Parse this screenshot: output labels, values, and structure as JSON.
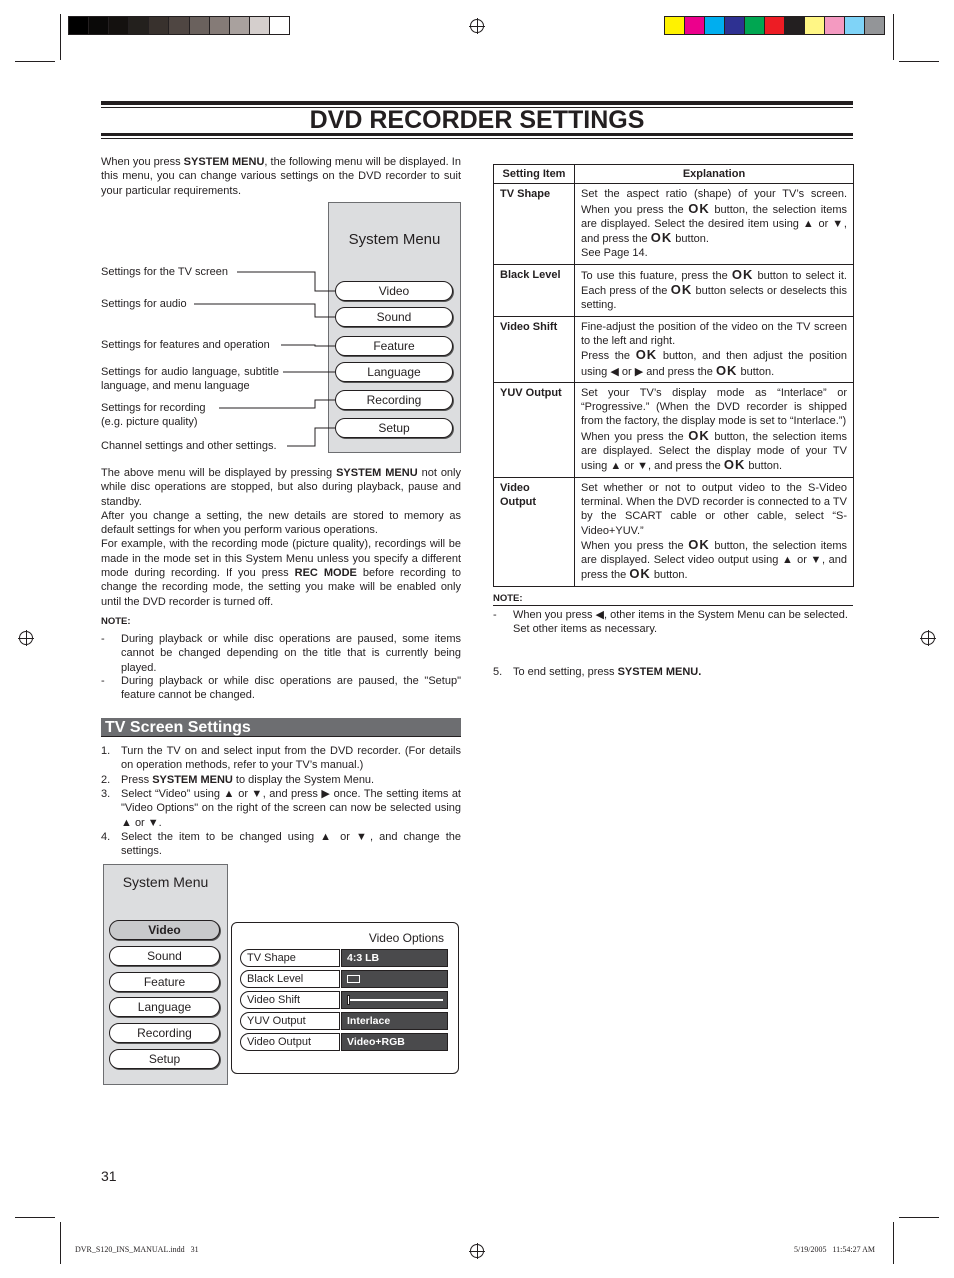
{
  "colors": {
    "grayscale": [
      "#000000",
      "#0a0908",
      "#14110f",
      "#23201d",
      "#38312d",
      "#4f4642",
      "#6a615d",
      "#857b77",
      "#a9a19e",
      "#d5cfcd",
      "#ffffff"
    ],
    "process": [
      "#fff200",
      "#ec008c",
      "#00aeef",
      "#2e3192",
      "#00a651",
      "#ed1c24",
      "#231f20",
      "#fff685",
      "#f49ac1",
      "#7fd3f7",
      "#939598"
    ],
    "section_header_bg": "#6d6e71"
  },
  "title": "DVD RECORDER SETTINGS",
  "intro": [
    "When you press ",
    {
      "b": "SYSTEM MENU"
    },
    ", the following menu will be displayed. In this menu, you can change various settings on the DVD recorder to suit your particular requirements."
  ],
  "diagram1": {
    "title": "System Menu",
    "buttons": [
      "Video",
      "Sound",
      "Feature",
      "Language",
      "Recording",
      "Setup"
    ],
    "labels": [
      "Settings for the TV screen",
      "Settings for audio",
      "Settings for features and operation",
      "Settings for audio language, subtitle language, and menu language",
      "Settings for recording (e.g. picture quality)",
      "Channel settings and other settings."
    ]
  },
  "para2": [
    "The above menu will be displayed by pressing ",
    {
      "b": "SYSTEM MENU"
    },
    " not only while disc operations are stopped, but also during playback, pause and standby.\nAfter you change a setting, the new details are stored to memory as default settings for when you perform various operations.\nFor example, with the recording mode (picture quality), recordings will be made in the mode set in this System Menu unless you specify a different mode during recording. If you press ",
    {
      "b": "REC MODE"
    },
    " before recording to change the recording mode, the setting you make will be enabled only until the DVD recorder is turned off."
  ],
  "note1": {
    "label": "NOTE:",
    "items": [
      "During playback or while disc operations are paused, some items cannot be changed depending on the title that is currently being played.",
      "During playback or while disc operations are paused, the \"Setup\" feature cannot be changed."
    ]
  },
  "section": "TV Screen Settings",
  "steps": [
    [
      "Turn the TV on and select input from the DVD recorder. (For details on operation methods, refer to your TV’s manual.)"
    ],
    [
      "Press ",
      {
        "b": "SYSTEM MENU"
      },
      "  to display the System Menu."
    ],
    [
      "Select “Video” using ▲ or ▼, and press ▶ once. The setting items at \"Video Options\" on the right of the screen can now be selected using ▲ or ▼."
    ],
    [
      "Select the item to be changed using ▲ or ▼, and change the settings."
    ]
  ],
  "diagram2": {
    "title": "System Menu",
    "buttons": [
      "Video",
      "Sound",
      "Feature",
      "Language",
      "Recording",
      "Setup"
    ],
    "selected": "Video",
    "options_title": "Video Options",
    "options": [
      {
        "label": "TV Shape",
        "value": "4:3 LB"
      },
      {
        "label": "Black Level",
        "value": ""
      },
      {
        "label": "Video Shift",
        "value": ""
      },
      {
        "label": "YUV Output",
        "value": "Interlace"
      },
      {
        "label": "Video Output",
        "value": "Video+RGB"
      }
    ]
  },
  "table": {
    "headers": [
      "Setting Item",
      "Explanation"
    ],
    "rows": [
      {
        "item": "TV Shape",
        "text": [
          "Set the aspect ratio (shape) of your TV’s screen. When you press the ",
          {
            "ok": "OK"
          },
          " button, the selection items are displayed. Select the desired item using ▲ or ▼, and press the ",
          {
            "ok": "OK"
          },
          " button.\nSee Page 14."
        ]
      },
      {
        "item": "Black Level",
        "text": [
          "To use this fuature, press the ",
          {
            "ok": "OK"
          },
          " button to select it. Each press of the ",
          {
            "ok": "OK"
          },
          " button selects or deselects this setting."
        ]
      },
      {
        "item": "Video Shift",
        "text": [
          "Fine-adjust the position of the video on the TV screen to the left and right.\nPress the ",
          {
            "ok": "OK"
          },
          " button, and then adjust the position using ◀ or ▶ and press the ",
          {
            "ok": "OK"
          },
          " button."
        ]
      },
      {
        "item": "YUV Output",
        "text": [
          "Set your TV’s display mode as “Interlace” or “Progressive.” (When the DVD recorder is shipped from the factory, the display mode is set to “Interlace.”)\nWhen you press the ",
          {
            "ok": "OK"
          },
          " button, the selection items are displayed. Select the display mode of your TV using ▲ or ▼, and press the ",
          {
            "ok": "OK"
          },
          " button."
        ]
      },
      {
        "item": "Video Output",
        "text": [
          "Set whether or not to output video to the S-Video terminal. When the DVD recorder is connected to a TV by the SCART cable or other cable, select “S-Video+YUV.”\nWhen you press the ",
          {
            "ok": "OK"
          },
          " button, the selection items are displayed. Select video output using ▲ or ▼, and press the ",
          {
            "ok": "OK"
          },
          " button."
        ]
      }
    ]
  },
  "note2": {
    "label": "NOTE:",
    "item": [
      "When you press ◀, other items in the System Menu can be selected.\nSet other items as necessary."
    ]
  },
  "step5": [
    "To end setting, press ",
    {
      "b": "SYSTEM MENU."
    }
  ],
  "page_number": "31",
  "footer_left": "DVR_S120_INS_MANUAL.indd   31",
  "footer_right": "5/19/2005   11:54:27 AM"
}
